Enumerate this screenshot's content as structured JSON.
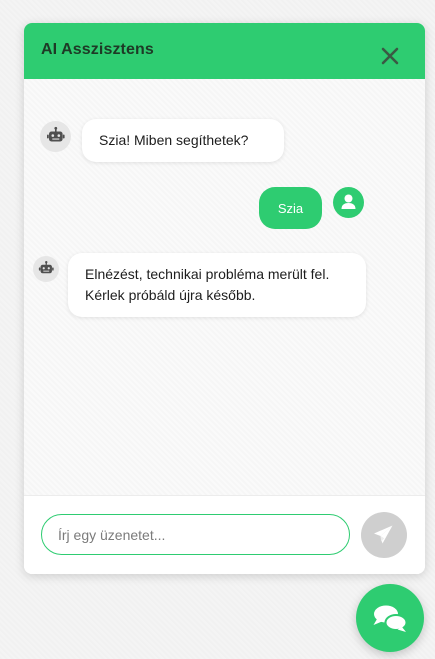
{
  "chat": {
    "title": "AI Asszisztens",
    "close_icon": "close-icon",
    "messages": [
      {
        "sender": "bot",
        "icon": "robot-icon",
        "text": "Szia! Miben segíthetek?"
      },
      {
        "sender": "user",
        "icon": "user-icon",
        "text": "Szia"
      },
      {
        "sender": "bot",
        "icon": "robot-icon",
        "text": "Elnézést, technikai probléma merült fel. Kérlek próbáld újra később."
      }
    ],
    "input": {
      "value": "",
      "placeholder": "Írj egy üzenetet..."
    },
    "send_icon": "paper-plane-icon"
  },
  "launcher": {
    "icon": "chat-bubbles-icon"
  },
  "colors": {
    "accent": "#2ecc71",
    "header_text": "#1e3a26",
    "send_disabled": "#cfcfcf",
    "bot_avatar_bg": "#e6e6e6"
  }
}
